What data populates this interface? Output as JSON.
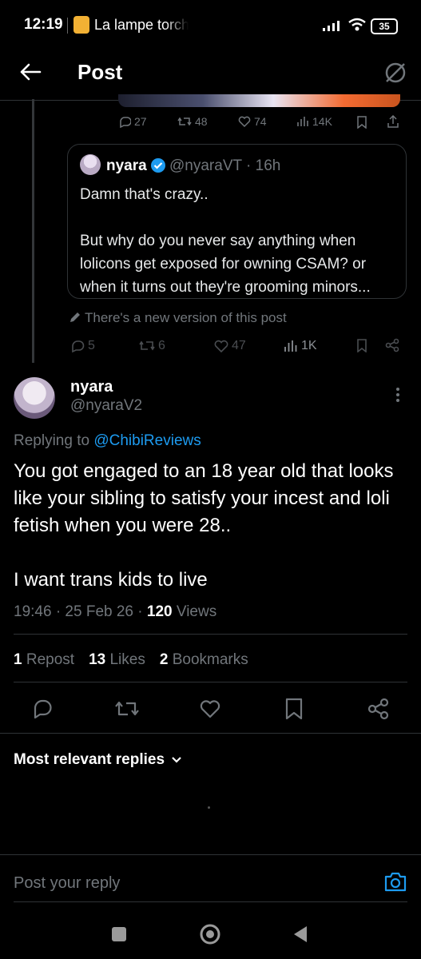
{
  "status_bar": {
    "time": "12:19",
    "app_title": "La lampe torche",
    "battery": "35"
  },
  "header": {
    "title": "Post"
  },
  "parent_stats": {
    "replies": "27",
    "reposts": "48",
    "likes": "74",
    "views": "14K"
  },
  "quote": {
    "name": "nyara",
    "handle_time": "@nyaraVT · 16h",
    "text": "Damn that's crazy..\n\nBut why do you never say anything when lolicons get exposed for owning CSAM? or when it turns out they're grooming minors..."
  },
  "new_version": "There's a new version of this post",
  "quote_stats": {
    "replies": "5",
    "reposts": "6",
    "likes": "47",
    "views": "1K"
  },
  "post": {
    "name": "nyara",
    "handle": "@nyaraV2",
    "replying_prefix": "Replying to ",
    "replying_to": "@ChibiReviews",
    "text": "You got engaged to an 18 year old that looks like your sibling to satisfy your incest and loli fetish when you were 28..\n\nI want trans kids to live",
    "time_date": "19:46 · 25 Feb 26 · ",
    "views_count": "120",
    "views_label": " Views"
  },
  "engagement": {
    "reposts_count": "1",
    "reposts_label": " Repost",
    "likes_count": "13",
    "likes_label": " Likes",
    "bookmarks_count": "2",
    "bookmarks_label": " Bookmarks"
  },
  "replies_sort": "Most relevant replies",
  "reply_placeholder": "Post your reply",
  "colors": {
    "accent": "#1d9bf0",
    "background": "#000000",
    "divider": "#2f3336",
    "muted": "#71767b"
  }
}
